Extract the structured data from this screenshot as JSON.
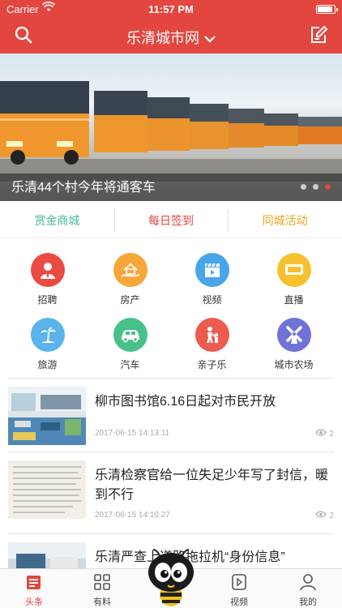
{
  "status": {
    "carrier": "Carrier",
    "time": "11:57 PM"
  },
  "nav": {
    "title": "乐清城市网",
    "search_icon": "search-icon",
    "edit_icon": "edit-icon",
    "bg_color": "#e2463f"
  },
  "banner": {
    "caption": "乐清44个村今年将通客车",
    "dots_total": 3,
    "active_dot": 3
  },
  "quick_links": [
    {
      "label": "赏金商城",
      "color": "#4cb89a"
    },
    {
      "label": "每日签到",
      "color": "#e2463f"
    },
    {
      "label": "同城活动",
      "color": "#f0a020"
    }
  ],
  "categories": [
    {
      "label": "招聘",
      "icon": "person-tie-icon",
      "color": "#ea4c44"
    },
    {
      "label": "房产",
      "icon": "house-hand-icon",
      "color": "#f7a63a"
    },
    {
      "label": "视频",
      "icon": "clapperboard-icon",
      "color": "#48a5e8"
    },
    {
      "label": "直播",
      "icon": "live-tag-icon",
      "color": "#f6c12f"
    },
    {
      "label": "旅游",
      "icon": "palm-tree-icon",
      "color": "#5ab3eb"
    },
    {
      "label": "汽车",
      "icon": "car-icon",
      "color": "#48c08a"
    },
    {
      "label": "亲子乐",
      "icon": "parent-child-icon",
      "color": "#ec5b4e"
    },
    {
      "label": "城市农场",
      "icon": "windmill-icon",
      "color": "#6f73d8"
    }
  ],
  "news": [
    {
      "title": "柳市图书馆6.16日起对市民开放",
      "time": "2017-06-15 14:13:11",
      "views": "2"
    },
    {
      "title": "乐清检察官给一位失足少年写了封信，暖到不行",
      "time": "2017-06-15 14:10:27",
      "views": "2"
    },
    {
      "title": "乐清严查上道路拖拉机“身份信息”",
      "time": "",
      "views": ""
    }
  ],
  "tabs": [
    {
      "label": "头条",
      "icon": "headline-icon",
      "active": true
    },
    {
      "label": "有料",
      "icon": "grid-icon",
      "active": false
    },
    {
      "label": "",
      "icon": "bee-mascot-icon",
      "active": false
    },
    {
      "label": "视频",
      "icon": "video-icon",
      "active": false
    },
    {
      "label": "我的",
      "icon": "profile-icon",
      "active": false
    }
  ]
}
